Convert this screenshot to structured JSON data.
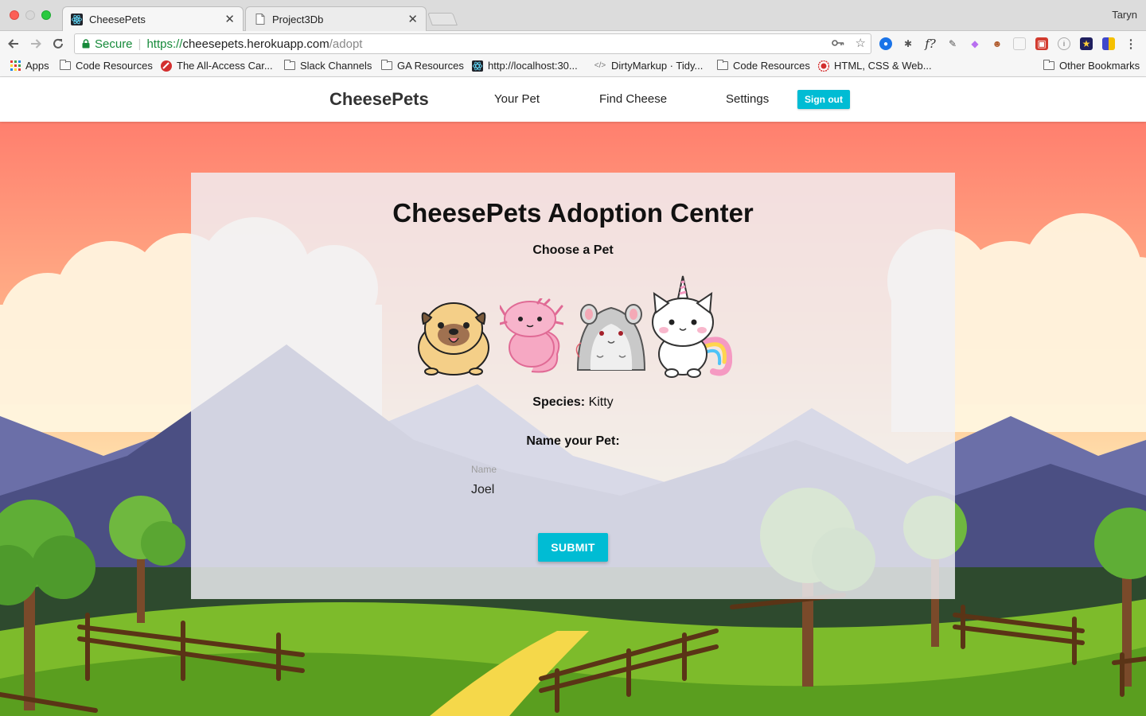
{
  "browser": {
    "tabs": [
      {
        "title": "CheesePets",
        "active": true
      },
      {
        "title": "Project3Db",
        "active": false
      }
    ],
    "profile": "Taryn",
    "omnibox": {
      "secure_label": "Secure",
      "url_scheme": "https://",
      "url_host": "cheesepets.herokuapp.com",
      "url_path": "/adopt"
    },
    "bookmarks": [
      {
        "label": "Apps",
        "icon": "apps-grid-icon"
      },
      {
        "label": "Code Resources",
        "icon": "folder-icon"
      },
      {
        "label": "The All-Access Car...",
        "icon": "red-circle-icon"
      },
      {
        "label": "Slack Channels",
        "icon": "folder-icon"
      },
      {
        "label": "GA Resources",
        "icon": "folder-icon"
      },
      {
        "label": "http://localhost:30...",
        "icon": "react-icon"
      },
      {
        "label": "DirtyMarkup · Tidy...",
        "icon": "code-icon"
      },
      {
        "label": "Code Resources",
        "icon": "folder-icon"
      },
      {
        "label": "HTML, CSS & Web...",
        "icon": "html-icon"
      },
      {
        "label": "Other Bookmarks",
        "icon": "folder-icon"
      }
    ]
  },
  "app": {
    "brand": "CheesePets",
    "nav": {
      "your_pet": "Your Pet",
      "find_cheese": "Find Cheese",
      "settings": "Settings",
      "sign_out": "Sign out"
    },
    "accent_color": "#00bcd4"
  },
  "adoption": {
    "title": "CheesePets Adoption Center",
    "choose_label": "Choose a Pet",
    "pets": [
      "pug",
      "axolotl",
      "chinchilla",
      "kitty"
    ],
    "species_label": "Species:",
    "species_value": "Kitty",
    "name_heading": "Name your Pet:",
    "name_field_label": "Name",
    "name_value": "Joel",
    "submit_label": "SUBMIT"
  }
}
